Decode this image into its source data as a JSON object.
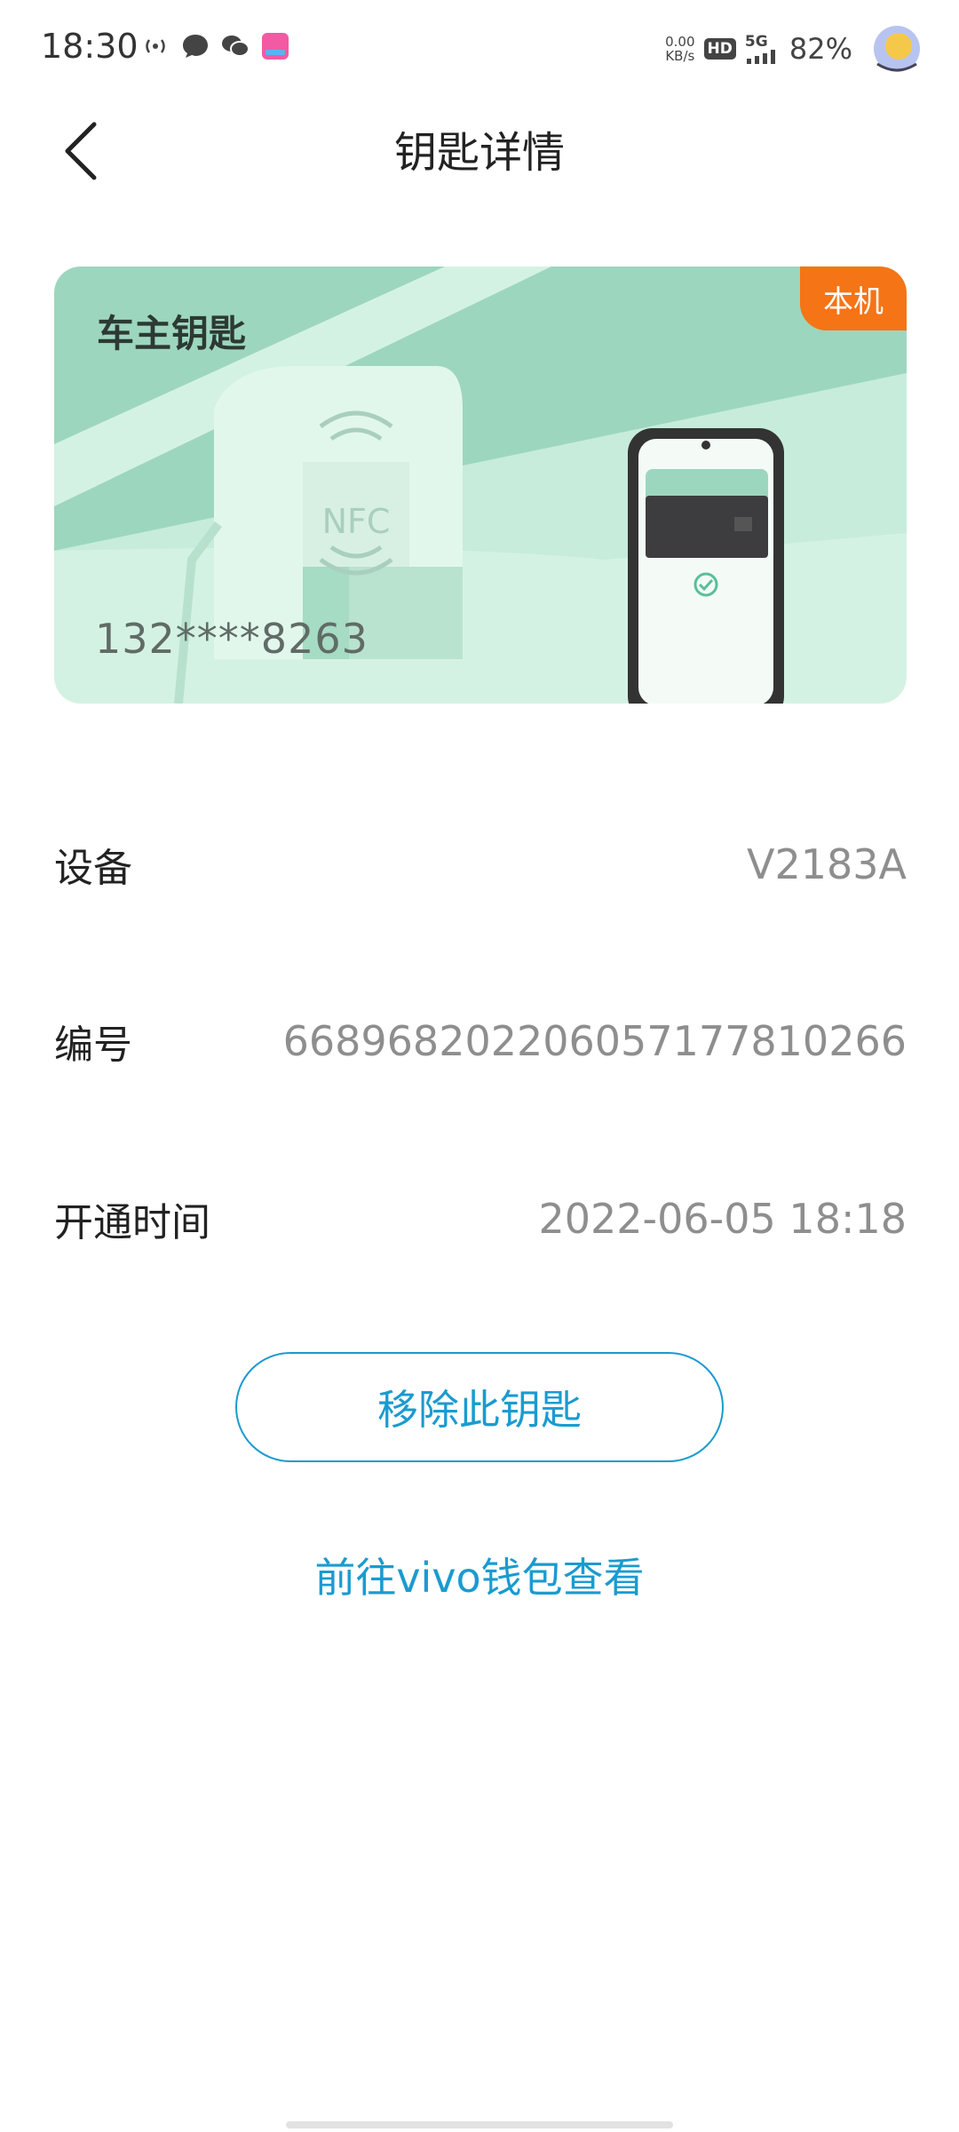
{
  "status_bar": {
    "time": "18:30",
    "net_speed_value": "0.00",
    "net_speed_unit": "KB/s",
    "hd": "HD",
    "network": "5G",
    "battery": "82%",
    "icons": [
      "hotspot-icon",
      "chat-bubble-icon",
      "wechat-icon",
      "app-notification-icon",
      "signal-icon",
      "avatar-icon"
    ]
  },
  "header": {
    "title": "钥匙详情",
    "back_icon": "chevron-left-icon"
  },
  "card": {
    "title": "车主钥匙",
    "phone_number": "132****8263",
    "badge": "本机",
    "nfc_label": "NFC",
    "colors": {
      "bg": "#d4f2e3",
      "accent": "#9dd6bf",
      "badge": "#f57415"
    }
  },
  "info": {
    "device_label": "设备",
    "device_value": "V2183A",
    "number_label": "编号",
    "number_value": "6689682022060571778 10266",
    "number_value_exact": "668968202206057177810266",
    "open_time_label": "开通时间",
    "open_time_value": "2022-06-05 18:18"
  },
  "actions": {
    "remove_label": "移除此钥匙",
    "wallet_link_label": "前往vivo钱包查看"
  },
  "colors": {
    "link": "#1a9bd0"
  }
}
